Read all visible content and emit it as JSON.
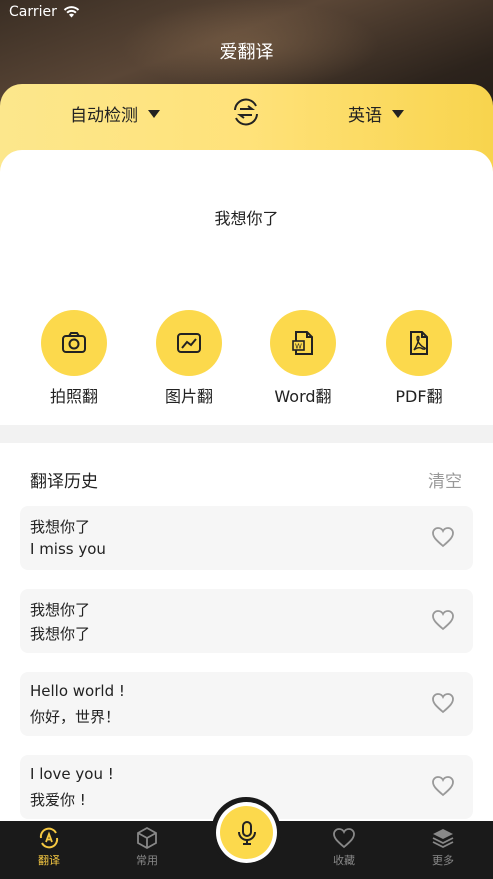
{
  "status": {
    "carrier": "Carrier"
  },
  "header": {
    "title": "爱翻译"
  },
  "languages": {
    "source": "自动检测",
    "target": "英语"
  },
  "input": {
    "text": "我想你了"
  },
  "tools": [
    {
      "label": "拍照翻",
      "icon": "camera-icon"
    },
    {
      "label": "图片翻",
      "icon": "image-icon"
    },
    {
      "label": "Word翻",
      "icon": "word-doc-icon"
    },
    {
      "label": "PDF翻",
      "icon": "pdf-icon"
    }
  ],
  "history": {
    "title": "翻译历史",
    "clear_label": "清空",
    "items": [
      {
        "source": "我想你了",
        "target": "I miss you"
      },
      {
        "source": "我想你了",
        "target": "我想你了"
      },
      {
        "source": "Hello world !",
        "target": "你好，世界！"
      },
      {
        "source": "I love you !",
        "target": "我爱你 !"
      }
    ]
  },
  "tabbar": {
    "items": [
      {
        "label": "翻译",
        "icon": "translate-icon",
        "active": true
      },
      {
        "label": "常用",
        "icon": "cube-icon",
        "active": false
      },
      {
        "label": "收藏",
        "icon": "heart-icon",
        "active": false
      },
      {
        "label": "更多",
        "icon": "layers-icon",
        "active": false
      }
    ]
  },
  "colors": {
    "accent": "#fcd94c",
    "tab_active": "#f5c842",
    "tabbar_bg": "#1a1a1a"
  }
}
